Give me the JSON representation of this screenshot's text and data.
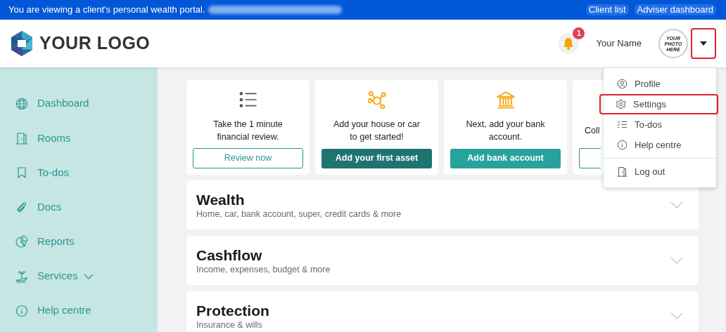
{
  "banner": {
    "message": "You are viewing a client's personal wealth portal.",
    "links": [
      "Client list",
      "Adviser dashboard"
    ]
  },
  "header": {
    "logo": "YOUR LOGO",
    "notifications": "1",
    "user_name": "Your Name",
    "avatar_text": "YOUR PHOTO HERE",
    "menu_button": {
      "highlighted": true
    }
  },
  "sidebar": {
    "items": [
      {
        "label": "Dashboard",
        "expandable": false
      },
      {
        "label": "Rooms",
        "expandable": false
      },
      {
        "label": "To-dos",
        "expandable": false
      },
      {
        "label": "Docs",
        "expandable": false
      },
      {
        "label": "Reports",
        "expandable": false
      },
      {
        "label": "Services",
        "expandable": true
      },
      {
        "label": "Help centre",
        "expandable": false
      }
    ]
  },
  "cards": [
    {
      "text": "Take the 1 minute financial review.",
      "button": "Review now"
    },
    {
      "text": "Add your house or car to get started!",
      "button": "Add your first asset"
    },
    {
      "text": "Next, add your bank account.",
      "button": "Add bank account"
    },
    {
      "text": "Coll"
    }
  ],
  "sections": [
    {
      "title": "Wealth",
      "subtitle": "Home, car, bank account, super, credit cards & more"
    },
    {
      "title": "Cashflow",
      "subtitle": "Income, expenses, budget & more"
    },
    {
      "title": "Protection",
      "subtitle": "Insurance & wills"
    }
  ],
  "user_menu": {
    "items": [
      {
        "label": "Profile",
        "highlighted": false
      },
      {
        "label": "Settings",
        "highlighted": true
      },
      {
        "label": "To-dos",
        "highlighted": false
      },
      {
        "label": "Help centre",
        "highlighted": false
      },
      {
        "label": "Log out",
        "highlighted": false
      }
    ]
  }
}
